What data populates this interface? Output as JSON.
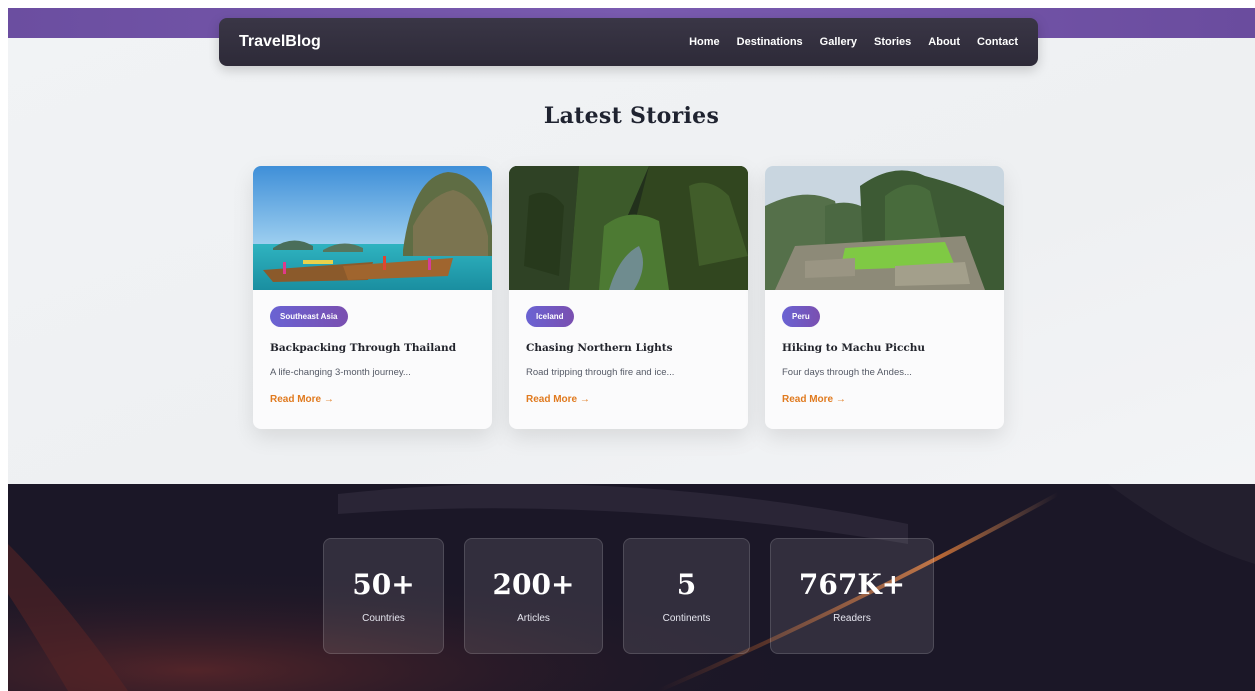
{
  "header": {
    "brand": "TravelBlog",
    "nav": [
      "Home",
      "Destinations",
      "Gallery",
      "Stories",
      "About",
      "Contact"
    ]
  },
  "stories": {
    "title": "Latest Stories",
    "cards": [
      {
        "tag": "Southeast Asia",
        "title": "Backpacking Through Thailand",
        "excerpt": "A life-changing 3-month journey...",
        "link": "Read More →"
      },
      {
        "tag": "Iceland",
        "title": "Chasing Northern Lights",
        "excerpt": "Road tripping through fire and ice...",
        "link": "Read More →"
      },
      {
        "tag": "Peru",
        "title": "Hiking to Machu Picchu",
        "excerpt": "Four days through the Andes...",
        "link": "Read More →"
      }
    ]
  },
  "stats": [
    {
      "value": "50+",
      "label": "Countries"
    },
    {
      "value": "200+",
      "label": "Articles"
    },
    {
      "value": "5",
      "label": "Continents"
    },
    {
      "value": "767K+",
      "label": "Readers"
    }
  ],
  "colors": {
    "nav_bg": "#2d2a38",
    "accent_orange": "#e07a1f",
    "tag_gradient_start": "#6a63d3",
    "tag_gradient_end": "#7a4fb0",
    "dark_bg": "#1b1727"
  }
}
